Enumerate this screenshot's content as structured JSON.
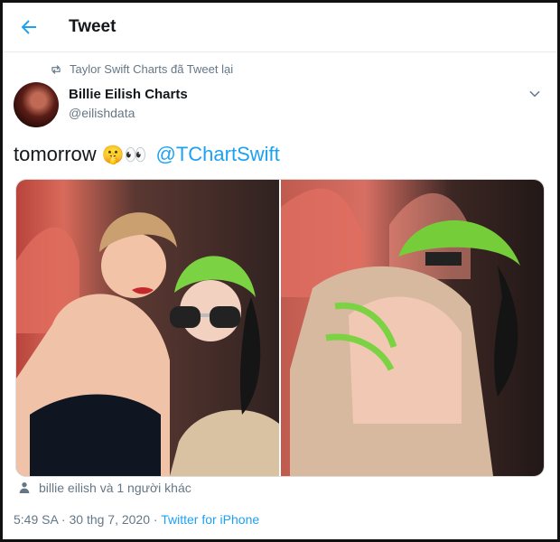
{
  "header": {
    "title": "Tweet"
  },
  "retweet": {
    "text": "Taylor Swift Charts đã Tweet lại"
  },
  "author": {
    "name": "Billie Eilish Charts",
    "handle": "@eilishdata"
  },
  "tweet": {
    "text": "tomorrow",
    "emoji": "🤫👀",
    "mention": "@TChartSwift"
  },
  "likes": {
    "text": "billie eilish và 1 người khác"
  },
  "meta": {
    "datetime": "5:49 SA · 30 thg 7, 2020 · ",
    "source": "Twitter for iPhone"
  },
  "colors": {
    "accent": "#1da1f2",
    "muted": "#657786",
    "text": "#14171a"
  }
}
